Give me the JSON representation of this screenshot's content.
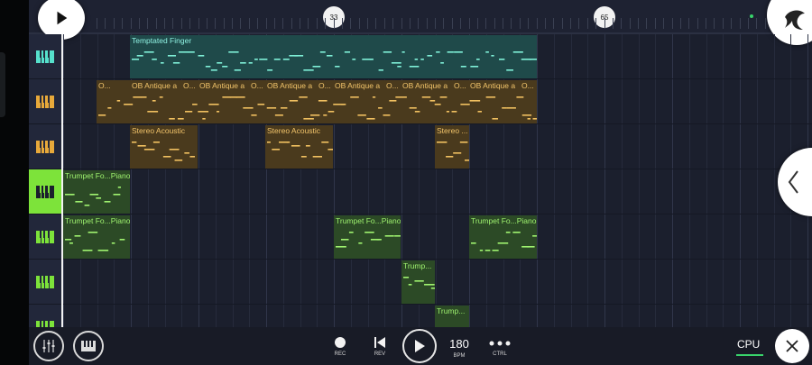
{
  "timeline": {
    "markers": [
      "33",
      "65"
    ]
  },
  "tracks": [
    {
      "id": 1,
      "color": "#56e0cc",
      "active": false,
      "clips": [
        {
          "label": "Temptated Finger",
          "fill": "#1f4a4a",
          "text": "#8ff2e2",
          "note": "#7ff0d8"
        }
      ]
    },
    {
      "id": 2,
      "color": "#e8a93a",
      "active": false,
      "clips": [
        {
          "label": "O...",
          "fill": "#4a3a1d",
          "text": "#f2c46a",
          "note": "#f0c060"
        },
        {
          "label": "OB Antique a",
          "fill": "#4a3a1d",
          "text": "#f2c46a",
          "note": "#f0c060"
        },
        {
          "label": "O...",
          "fill": "#4a3a1d",
          "text": "#f2c46a",
          "note": "#f0c060"
        }
      ]
    },
    {
      "id": 3,
      "color": "#e8a93a",
      "active": false,
      "clips": [
        {
          "label": "Stereo Acoustic",
          "fill": "#4a3a1d",
          "text": "#f2c46a",
          "note": "#f0c060"
        },
        {
          "label": "Stereo ...",
          "fill": "#4a3a1d",
          "text": "#f2c46a",
          "note": "#f0c060"
        }
      ]
    },
    {
      "id": 4,
      "color": "#7de33a",
      "active": true,
      "clips": [
        {
          "label": "Trumpet Fo...Piano",
          "fill": "#2c4a26",
          "text": "#9ff26f",
          "note": "#9ff26f"
        }
      ]
    },
    {
      "id": 5,
      "color": "#7de33a",
      "active": false,
      "clips": [
        {
          "label": "Trumpet Fo...Piano",
          "fill": "#2c4a26",
          "text": "#9ff26f",
          "note": "#9ff26f"
        }
      ]
    },
    {
      "id": 6,
      "color": "#7de33a",
      "active": false,
      "clips": [
        {
          "label": "Trump...",
          "fill": "#2c4a26",
          "text": "#9ff26f",
          "note": "#9ff26f"
        }
      ]
    },
    {
      "id": 7,
      "color": "#7de33a",
      "active": false,
      "clips": [
        {
          "label": "Trump...",
          "fill": "#2c4a26",
          "text": "#9ff26f",
          "note": "#9ff26f"
        }
      ]
    }
  ],
  "transport": {
    "rec_label": "REC",
    "rev_label": "REV",
    "bpm_value": "180",
    "bpm_label": "BPM",
    "ctrl_label": "CTRL"
  },
  "status": {
    "cpu_label": "CPU",
    "cpu_color": "#39d46b"
  },
  "icons": [
    "play-icon",
    "app-logo-icon",
    "mixer-icon",
    "piano-roll-icon",
    "record-icon",
    "rewind-icon",
    "more-icon",
    "close-icon",
    "chevron-left-icon",
    "keyboard-icon"
  ]
}
